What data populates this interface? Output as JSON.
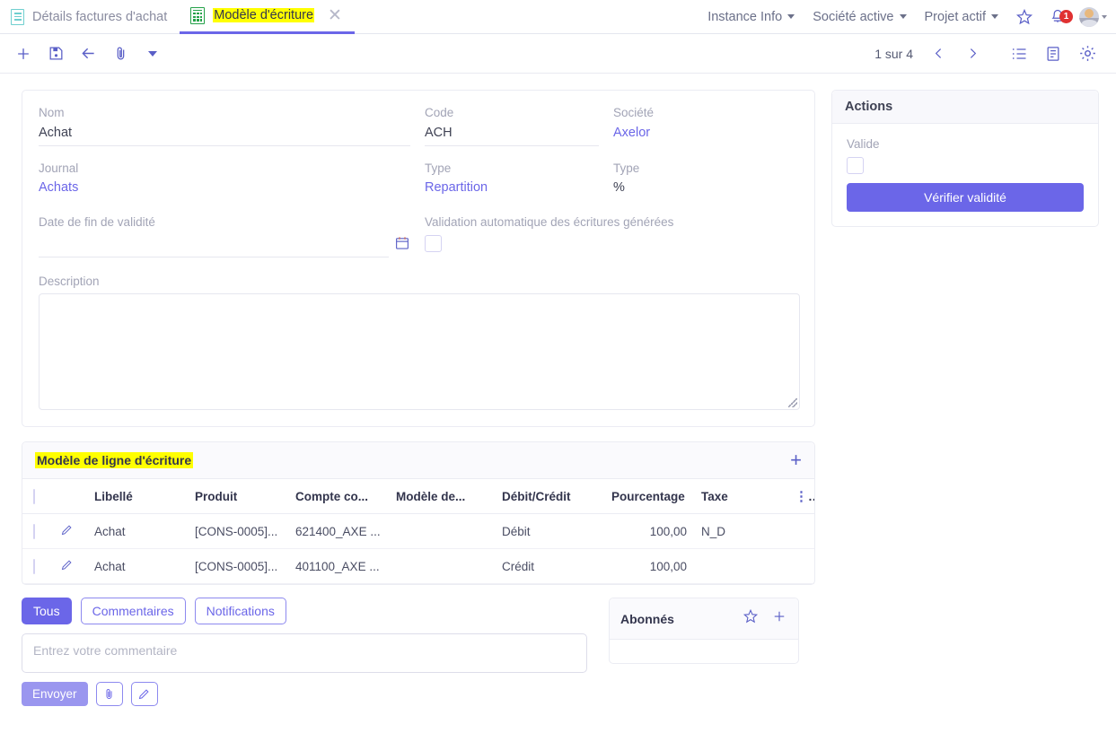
{
  "tabs": [
    {
      "label": "Détails factures d'achat",
      "icon": "document-icon",
      "active": false
    },
    {
      "label": "Modèle d'écriture",
      "icon": "calculator-icon",
      "active": true
    }
  ],
  "topbar": {
    "menus": [
      "Instance Info",
      "Société active",
      "Projet actif"
    ],
    "star_icon": "star-icon",
    "bell_icon": "bell-icon",
    "notification_count": "1",
    "avatar_icon": "user-avatar-icon"
  },
  "toolbar": {
    "new_icon": "plus-icon",
    "save_icon": "save-icon",
    "back_icon": "arrow-left-icon",
    "attach_icon": "paperclip-icon",
    "more_icon": "chevron-down-icon",
    "pager_text": "1 sur 4",
    "prev_icon": "chevron-left-icon",
    "next_icon": "chevron-right-icon",
    "list_icon": "list-view-icon",
    "form_icon": "form-view-icon",
    "settings_icon": "gear-icon"
  },
  "form": {
    "fields": {
      "nom": {
        "label": "Nom",
        "value": "Achat"
      },
      "code": {
        "label": "Code",
        "value": "ACH"
      },
      "societe": {
        "label": "Société",
        "value": "Axelor"
      },
      "journal": {
        "label": "Journal",
        "value": "Achats"
      },
      "type_repartition": {
        "label": "Type",
        "value": "Repartition"
      },
      "type_pct": {
        "label": "Type",
        "value": "%"
      },
      "date_fin": {
        "label": "Date de fin de validité",
        "value": "",
        "icon": "calendar-icon"
      },
      "validation_auto": {
        "label": "Validation automatique des écritures générées",
        "checked": false
      },
      "description": {
        "label": "Description",
        "value": ""
      }
    }
  },
  "actions_panel": {
    "title": "Actions",
    "valide_label": "Valide",
    "valide_checked": false,
    "verify_button": "Vérifier validité"
  },
  "grid": {
    "title": "Modèle de ligne d'écriture",
    "add_icon": "plus-icon",
    "kebab_icon": "kebab-menu-icon",
    "columns": [
      "Libellé",
      "Produit",
      "Compte co...",
      "Modèle de...",
      "Débit/Crédit",
      "Pourcentage",
      "Taxe"
    ],
    "rows": [
      {
        "libelle": "Achat",
        "produit": "[CONS-0005]...",
        "compte": "621400_AXE ...",
        "modele": "",
        "debit_credit": "Débit",
        "pourcentage": "100,00",
        "taxe": "N_D"
      },
      {
        "libelle": "Achat",
        "produit": "[CONS-0005]...",
        "compte": "401100_AXE ...",
        "modele": "",
        "debit_credit": "Crédit",
        "pourcentage": "100,00",
        "taxe": ""
      }
    ]
  },
  "comments": {
    "chips": [
      "Tous",
      "Commentaires",
      "Notifications"
    ],
    "active_chip": "Tous",
    "placeholder": "Entrez votre commentaire",
    "send_label": "Envoyer",
    "attach_icon": "paperclip-icon",
    "edit_icon": "pencil-icon"
  },
  "subscribers": {
    "title": "Abonnés",
    "star_icon": "star-icon",
    "add_icon": "plus-icon"
  },
  "colors": {
    "accent": "#6b66e8",
    "highlight": "#ffff00",
    "badge": "#e03131",
    "doc_icon": "#6fcfcf",
    "calc_icon": "#23a148"
  }
}
